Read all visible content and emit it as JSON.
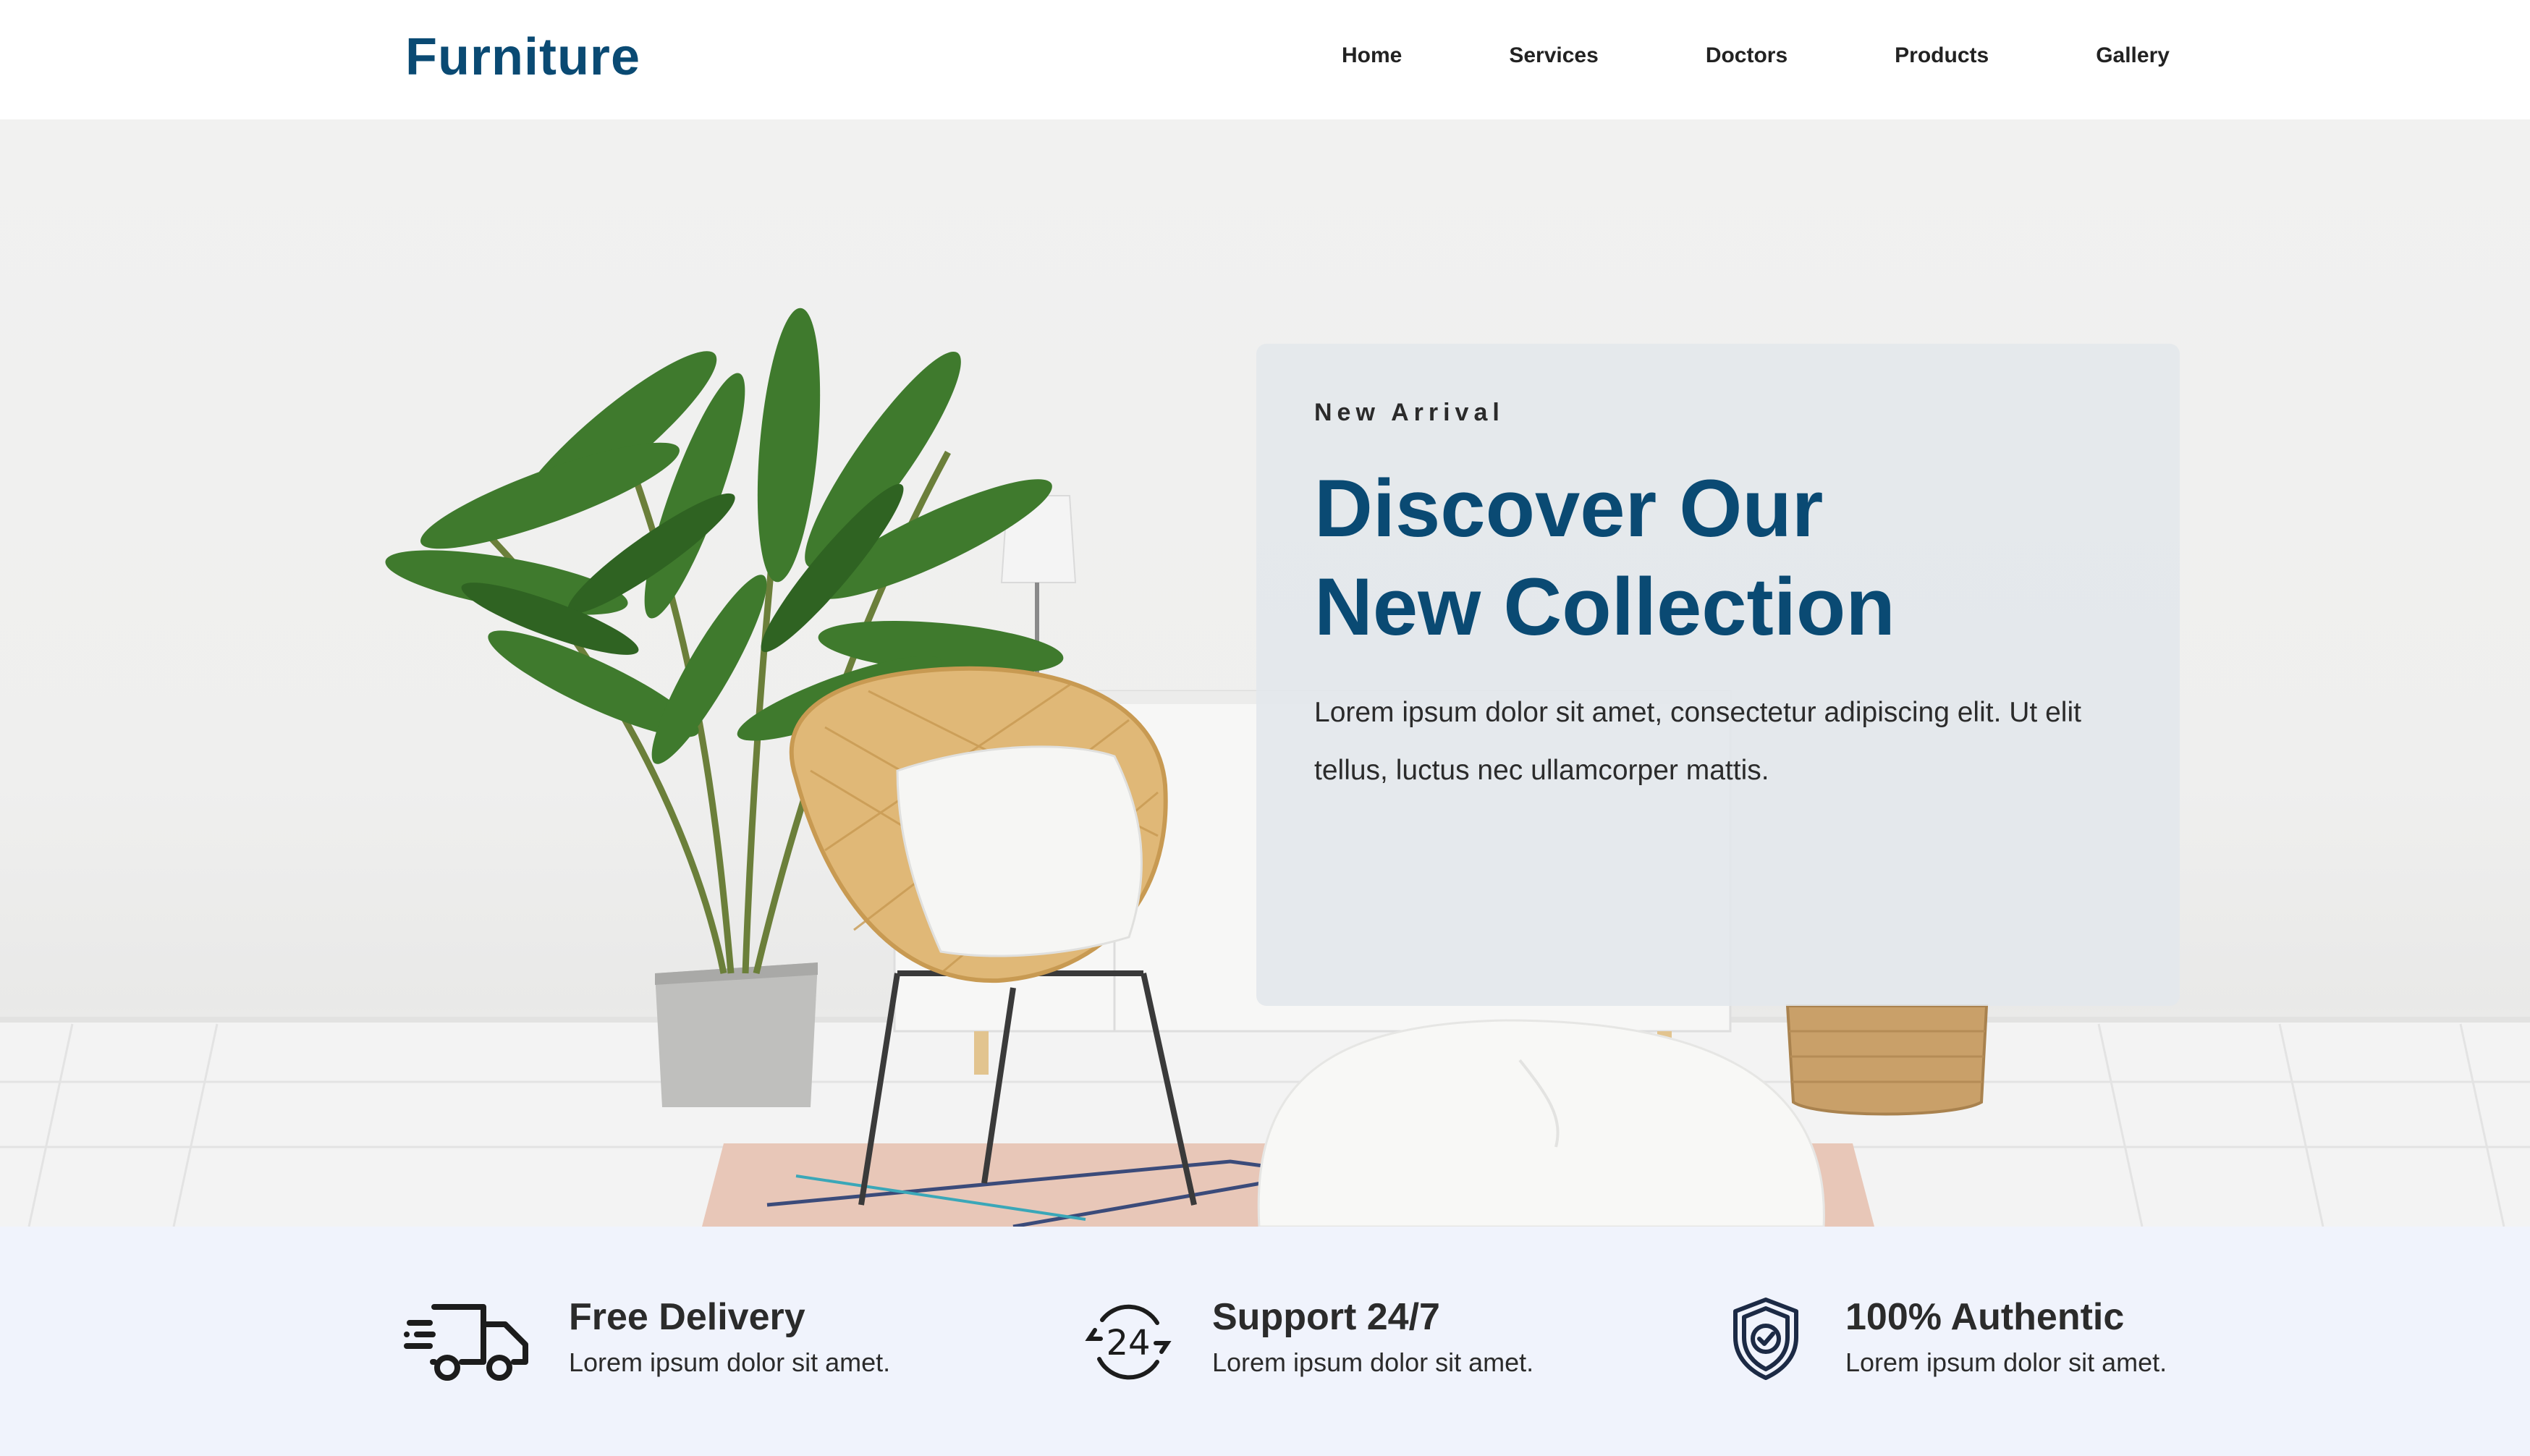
{
  "header": {
    "logo": "Furniture",
    "nav": [
      "Home",
      "Services",
      "Doctors",
      "Products",
      "Gallery"
    ]
  },
  "hero": {
    "eyebrow": "New Arrival",
    "headline_line1": "Discover Our",
    "headline_line2": "New Collection",
    "description": "Lorem ipsum dolor sit amet, consectetur adipiscing elit. Ut elit tellus, luctus nec ullamcorper mattis."
  },
  "features": [
    {
      "icon": "delivery-truck-icon",
      "title": "Free Delivery",
      "subtitle": "Lorem ipsum dolor sit amet."
    },
    {
      "icon": "support-24-7-icon",
      "title": "Support 24/7",
      "subtitle": "Lorem ipsum dolor sit amet."
    },
    {
      "icon": "shield-check-icon",
      "title": "100% Authentic",
      "subtitle": "Lorem ipsum dolor sit amet."
    }
  ],
  "colors": {
    "brand": "#0a4a73",
    "text": "#2b2b2b",
    "features_bg": "#f0f3fc",
    "card_bg": "#e2e7ec"
  }
}
